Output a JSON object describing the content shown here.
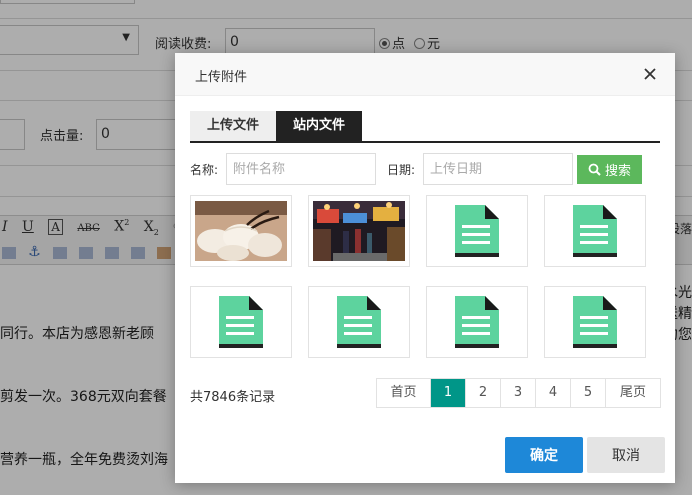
{
  "background": {
    "reading_fee_label": "阅读收费:",
    "reading_fee_value": "0",
    "radio_point": "点",
    "radio_yuan": "元",
    "click_count_label": "点击量:",
    "click_count_value": "0",
    "content_lines": [
      "同行。本店为感恩新老顾",
      "剪发一次。368元双向套餐",
      "营养一瓶，全年免费烫刘海"
    ],
    "right_fragments": [
      "水光",
      "送精",
      "约您"
    ],
    "toolbar_right": "设落"
  },
  "dialog": {
    "title": "上传附件",
    "tabs": [
      "上传文件",
      "站内文件"
    ],
    "active_tab": "站内文件",
    "search": {
      "name_label": "名称:",
      "name_placeholder": "附件名称",
      "date_label": "日期:",
      "date_placeholder": "上传日期",
      "button_label": "搜索"
    },
    "files": [
      {
        "type": "image",
        "icon": "dumplings-photo"
      },
      {
        "type": "image",
        "icon": "night-market-photo"
      },
      {
        "type": "document",
        "icon": "document-icon"
      },
      {
        "type": "document",
        "icon": "document-icon"
      },
      {
        "type": "document",
        "icon": "document-icon"
      },
      {
        "type": "document",
        "icon": "document-icon"
      },
      {
        "type": "document",
        "icon": "document-icon"
      },
      {
        "type": "document",
        "icon": "document-icon"
      }
    ],
    "record_count": "共7846条记录",
    "pagination": {
      "first": "首页",
      "pages": [
        "1",
        "2",
        "3",
        "4",
        "5"
      ],
      "current": "1",
      "last": "尾页"
    },
    "confirm_label": "确定",
    "cancel_label": "取消"
  },
  "colors": {
    "accent_green": "#5cb85c",
    "page_active": "#009688",
    "confirm_blue": "#1e88d8",
    "doc_icon_green": "#5dd39e"
  }
}
